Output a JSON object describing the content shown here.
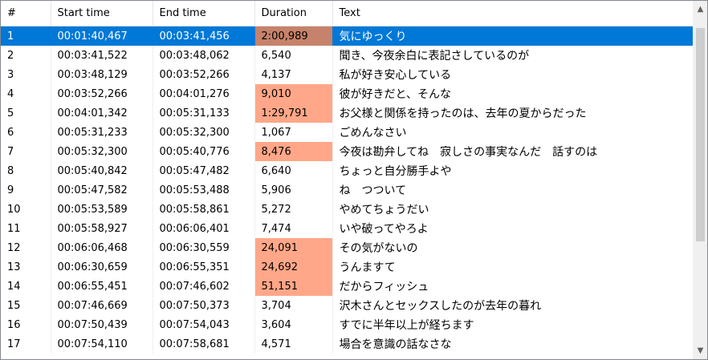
{
  "columns": [
    "#",
    "Start time",
    "End time",
    "Duration",
    "Text"
  ],
  "selected_row_index": 0,
  "rows": [
    {
      "num": "1",
      "start": "00:01:40,467",
      "end": "00:03:41,456",
      "duration": "2:00,989",
      "text": "気にゆっくり",
      "highlight": true
    },
    {
      "num": "2",
      "start": "00:03:41,522",
      "end": "00:03:48,062",
      "duration": "6,540",
      "text": "聞き、今夜余白に表記さしているのが",
      "highlight": false
    },
    {
      "num": "3",
      "start": "00:03:48,129",
      "end": "00:03:52,266",
      "duration": "4,137",
      "text": "私が好き安心している",
      "highlight": false
    },
    {
      "num": "4",
      "start": "00:03:52,266",
      "end": "00:04:01,276",
      "duration": "9,010",
      "text": "彼が好きだと、そんな",
      "highlight": true
    },
    {
      "num": "5",
      "start": "00:04:01,342",
      "end": "00:05:31,133",
      "duration": "1:29,791",
      "text": "お父様と関係を持ったのは、去年の夏からだった",
      "highlight": true
    },
    {
      "num": "6",
      "start": "00:05:31,233",
      "end": "00:05:32,300",
      "duration": "1,067",
      "text": "ごめんなさい",
      "highlight": false
    },
    {
      "num": "7",
      "start": "00:05:32,300",
      "end": "00:05:40,776",
      "duration": "8,476",
      "text": "今夜は勘弁してね　寂しさの事実なんだ　話すのは",
      "highlight": true
    },
    {
      "num": "8",
      "start": "00:05:40,842",
      "end": "00:05:47,482",
      "duration": "6,640",
      "text": "ちょっと自分勝手よや",
      "highlight": false
    },
    {
      "num": "9",
      "start": "00:05:47,582",
      "end": "00:05:53,488",
      "duration": "5,906",
      "text": "ね　つついて",
      "highlight": false
    },
    {
      "num": "10",
      "start": "00:05:53,589",
      "end": "00:05:58,861",
      "duration": "5,272",
      "text": "やめてちょうだい",
      "highlight": false
    },
    {
      "num": "11",
      "start": "00:05:58,927",
      "end": "00:06:06,401",
      "duration": "7,474",
      "text": "いや破ってやろよ",
      "highlight": false
    },
    {
      "num": "12",
      "start": "00:06:06,468",
      "end": "00:06:30,559",
      "duration": "24,091",
      "text": "その気がないの",
      "highlight": true
    },
    {
      "num": "13",
      "start": "00:06:30,659",
      "end": "00:06:55,351",
      "duration": "24,692",
      "text": "うんますて",
      "highlight": true
    },
    {
      "num": "14",
      "start": "00:06:55,451",
      "end": "00:07:46,602",
      "duration": "51,151",
      "text": "だからフィッシュ",
      "highlight": true
    },
    {
      "num": "15",
      "start": "00:07:46,669",
      "end": "00:07:50,373",
      "duration": "3,704",
      "text": "沢木さんとセックスしたのが去年の暮れ",
      "highlight": false
    },
    {
      "num": "16",
      "start": "00:07:50,439",
      "end": "00:07:54,043",
      "duration": "3,604",
      "text": "すでに半年以上が経ちます",
      "highlight": false
    },
    {
      "num": "17",
      "start": "00:07:54,110",
      "end": "00:07:58,681",
      "duration": "4,571",
      "text": "場合を意識の話なさな",
      "highlight": false
    }
  ],
  "scrollbar": {
    "up_icon": "▲",
    "down_icon": "▼"
  }
}
